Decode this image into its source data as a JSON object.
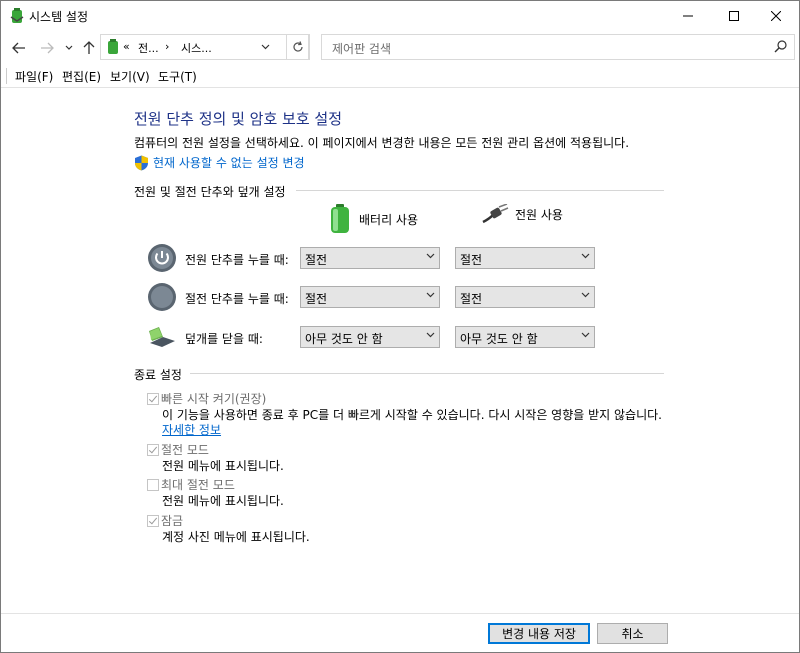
{
  "window": {
    "title": "시스템 설정"
  },
  "nav": {
    "back_icon": "back-arrow-icon",
    "forward_icon": "forward-arrow-icon",
    "up_icon": "up-arrow-icon",
    "breadcrumb_sep": "«",
    "breadcrumb": [
      "전...",
      "시스..."
    ],
    "crumb_arrow": "›"
  },
  "search": {
    "placeholder": "제어판 검색"
  },
  "menu": [
    "파일(F)",
    "편집(E)",
    "보기(V)",
    "도구(T)"
  ],
  "page": {
    "title": "전원 단추 정의 및 암호 보호 설정",
    "description": "컴퓨터의 전원 설정을 선택하세요. 이 페이지에서 변경한 내용은 모든 전원 관리 옵션에 적용됩니다.",
    "change_link": "현재 사용할 수 없는 설정 변경"
  },
  "power_section": {
    "heading": "전원 및 절전 단추와 덮개 설정",
    "col_battery": "배터리 사용",
    "col_plugged": "전원 사용",
    "rows": [
      {
        "label": "전원 단추를 누를 때:",
        "battery": "절전",
        "plugged": "절전"
      },
      {
        "label": "절전 단추를 누를 때:",
        "battery": "절전",
        "plugged": "절전"
      },
      {
        "label": "덮개를 닫을 때:",
        "battery": "아무 것도 안 함",
        "plugged": "아무 것도 안 함"
      }
    ]
  },
  "shutdown_section": {
    "heading": "종료 설정",
    "options": [
      {
        "label": "빠른 시작 켜기(권장)",
        "checked": true,
        "desc": "이 기능을 사용하면 종료 후 PC를 더 빠르게 시작할 수 있습니다. 다시 시작은 영향을 받지 않습니다.",
        "link": "자세한 정보"
      },
      {
        "label": "절전 모드",
        "checked": true,
        "desc": "전원 메뉴에 표시됩니다."
      },
      {
        "label": "최대 절전 모드",
        "checked": false,
        "desc": "전원 메뉴에 표시됩니다."
      },
      {
        "label": "잠금",
        "checked": true,
        "desc": "계정 사진 메뉴에 표시됩니다."
      }
    ]
  },
  "buttons": {
    "save": "변경 내용 저장",
    "cancel": "취소"
  },
  "colors": {
    "title_blue": "#1e3287",
    "link_blue": "#0066cc",
    "accent": "#0078d7"
  }
}
